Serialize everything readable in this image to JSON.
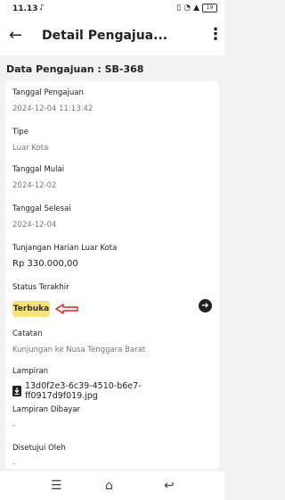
{
  "status_bar": {
    "time": "11.13",
    "battery": "19"
  },
  "app_bar": {
    "title": "Detail Pengajua..."
  },
  "section_title": "Data Pengajuan : SB-368",
  "fields": [
    {
      "label": "Tanggal Pengajuan",
      "value": "2024-12-04 11:13:42"
    },
    {
      "label": "Tipe",
      "value": "Luar Kota"
    },
    {
      "label": "Tanggal Mulai",
      "value": "2024-12-02"
    },
    {
      "label": "Tanggal Selesai",
      "value": "2024-12-04"
    },
    {
      "label": "Tunjangan Harian Luar Kota",
      "value": "Rp 330.000,00"
    }
  ],
  "status": {
    "label": "Status Terakhir",
    "value": "Terbuka",
    "badge_color": "#f7e17a",
    "arrow_color": "#e02020"
  },
  "catatan": {
    "label": "Catatan",
    "value": "Kunjungan ke Nusa Tenggara Barat"
  },
  "lampiran": {
    "label": "Lampiran",
    "file": "13d0f2e3-6c39-4510-b6e7-ff0917d9f019.jpg",
    "icon": "download-icon"
  },
  "lampiran_dibayar": {
    "label": "Lampiran Dibayar",
    "value": "-"
  },
  "disetujui_oleh": {
    "label": "Disetujui Oleh",
    "value": "-"
  }
}
